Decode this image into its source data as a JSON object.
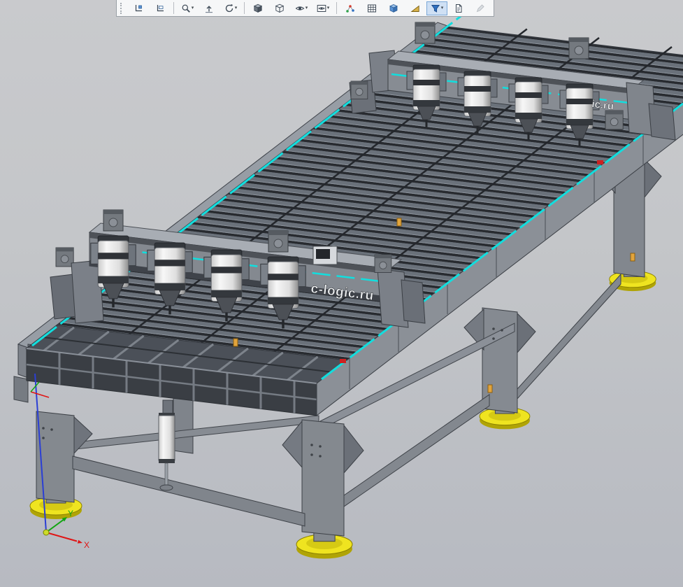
{
  "window": {
    "background_top": "#c9cacd",
    "background_bottom": "#b7bac1"
  },
  "toolbar": {
    "dropdown_glyph": "▾",
    "buttons": [
      {
        "label": "Show all",
        "icon": "corner-ruler-icon"
      },
      {
        "label": "Zoom to selection",
        "icon": "corner-ruler-plus-icon"
      },
      {
        "label": "Zoom",
        "icon": "magnifier-icon",
        "dropdown": true
      },
      {
        "label": "Normal to",
        "icon": "arrow-up-icon"
      },
      {
        "label": "Rotate view",
        "icon": "rotate-icon",
        "dropdown": true
      },
      {
        "label": "Shaded with edges",
        "icon": "cube-shaded-icon"
      },
      {
        "label": "Wireframe",
        "icon": "cube-wire-icon"
      },
      {
        "label": "Hide / show items",
        "icon": "eye-icon",
        "dropdown": true
      },
      {
        "label": "Scene appearance",
        "icon": "eye-box-icon",
        "dropdown": true
      },
      {
        "label": "Constraints",
        "icon": "points-icon"
      },
      {
        "label": "Parameters table",
        "icon": "grid-icon"
      },
      {
        "label": "Components",
        "icon": "component-icon"
      },
      {
        "label": "Draft angle",
        "icon": "wedge-icon"
      },
      {
        "label": "Filter objects",
        "icon": "funnel-icon",
        "dropdown": true,
        "active": true
      },
      {
        "label": "Report",
        "icon": "document-icon"
      },
      {
        "label": "Edit",
        "icon": "pencil-icon",
        "disabled": true
      }
    ]
  },
  "viewport": {
    "watermark_front": "c-logic.ru",
    "watermark_rear": "ic.ru",
    "axis_labels": {
      "x": "X",
      "y": "Y"
    },
    "colors": {
      "rail_accent": "#12dede",
      "foot_yellow": "#efe420",
      "axis_x": "#e01414",
      "axis_y": "#12a512",
      "axis_z": "#2b3fd4",
      "machine_gray": "#878c93"
    }
  }
}
